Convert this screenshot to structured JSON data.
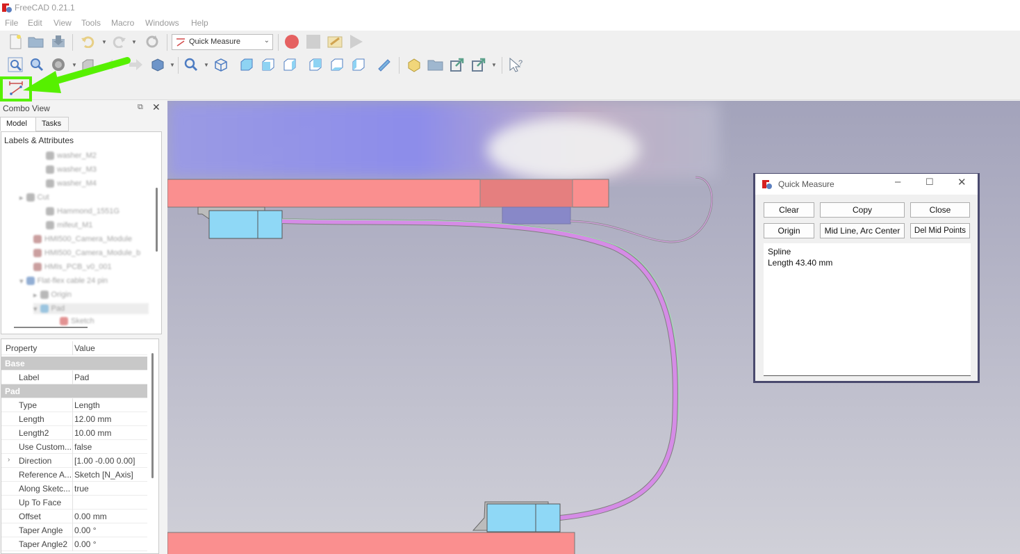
{
  "window": {
    "title": "FreeCAD 0.21.1"
  },
  "menu": [
    "File",
    "Edit",
    "View",
    "Tools",
    "Macro",
    "Windows",
    "Help"
  ],
  "workbench": {
    "selected": "Quick Measure"
  },
  "combo_view": {
    "title": "Combo View",
    "tabs": [
      "Model",
      "Tasks"
    ],
    "tree_header": "Labels & Attributes"
  },
  "properties": {
    "headers": {
      "property": "Property",
      "value": "Value"
    },
    "rows": [
      {
        "kind": "group",
        "key": "Base"
      },
      {
        "kind": "item",
        "key": "Label",
        "value": "Pad"
      },
      {
        "kind": "group",
        "key": "Pad"
      },
      {
        "kind": "item",
        "key": "Type",
        "value": "Length"
      },
      {
        "kind": "item",
        "key": "Length",
        "value": "12.00 mm"
      },
      {
        "kind": "item",
        "key": "Length2",
        "value": "10.00 mm"
      },
      {
        "kind": "item",
        "key": "Use Custom...",
        "value": "false"
      },
      {
        "kind": "item",
        "key": "Direction",
        "value": "[1.00 -0.00 0.00]",
        "expandable": true
      },
      {
        "kind": "item",
        "key": "Reference A...",
        "value": "Sketch [N_Axis]"
      },
      {
        "kind": "item",
        "key": "Along Sketc...",
        "value": "true"
      },
      {
        "kind": "item",
        "key": "Up To Face",
        "value": ""
      },
      {
        "kind": "item",
        "key": "Offset",
        "value": "0.00 mm"
      },
      {
        "kind": "item",
        "key": "Taper Angle",
        "value": "0.00 °"
      },
      {
        "kind": "item",
        "key": "Taper Angle2",
        "value": "0.00 °"
      }
    ]
  },
  "quick_measure": {
    "title": "Quick Measure",
    "buttons": {
      "clear": "Clear",
      "copy": "Copy",
      "close": "Close",
      "origin": "Origin",
      "mid_line": "Mid Line, Arc Center",
      "del_mid": "Del Mid Points"
    },
    "output": {
      "line1": "Spline",
      "line2": "Length 43.40 mm"
    }
  },
  "colors": {
    "highlight": "#56f000",
    "part": "#fa8f8f",
    "connector": "#8fd8f6",
    "cable": "#d58ce6",
    "dialog_border": "#4a4a6e"
  }
}
